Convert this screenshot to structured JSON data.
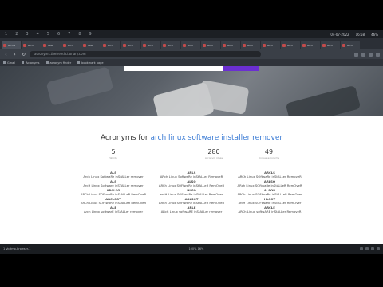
{
  "topbar": {
    "workspaces": [
      "1",
      "2",
      "3",
      "4",
      "5",
      "6",
      "7",
      "8",
      "9"
    ],
    "right_items": [
      "04-07-2022",
      "16:58",
      "46%"
    ]
  },
  "tabs": [
    {
      "title": "Arch L"
    },
    {
      "title": "Arch"
    },
    {
      "title": "Mod"
    },
    {
      "title": "Arch"
    },
    {
      "title": "Mod"
    },
    {
      "title": "Arch"
    },
    {
      "title": "Arch"
    },
    {
      "title": "Arch"
    },
    {
      "title": "Arch"
    },
    {
      "title": "Arch"
    },
    {
      "title": "Arch"
    },
    {
      "title": "Arch"
    },
    {
      "title": "Arch"
    },
    {
      "title": "Arch"
    },
    {
      "title": "Arch"
    },
    {
      "title": "Arch"
    },
    {
      "title": "Arch"
    },
    {
      "title": "Arch"
    }
  ],
  "urlbar": {
    "address": "acronyms.thefreedictionary.com"
  },
  "bookmarks": [
    "Gmail",
    "Acronyms",
    "acronym finder",
    "bookmark page"
  ],
  "main": {
    "heading_prefix": "Acronyms for",
    "heading_highlight": "arch linux software installer remover",
    "stats": [
      {
        "value": "5",
        "label": "Words"
      },
      {
        "value": "280",
        "label": "Acronym ideas"
      },
      {
        "value": "49",
        "label": "Unique acronyms"
      }
    ],
    "columns": [
      [
        {
          "acronym": "ALS",
          "expansion": "Arch Linux SoftwaRe inStALLer remover"
        },
        {
          "acronym": "ALS",
          "expansion": "ArcH Linux Software inSTALLer remover"
        },
        {
          "acronym": "ARCLSO",
          "expansion": "ARCh Linux SOFtwaRe inStALLeR RemOveR"
        },
        {
          "acronym": "ARCLSOT",
          "expansion": "ARCh Linux SOFtwaRe inStALLeR RemOveR"
        },
        {
          "acronym": "ALE",
          "expansion": "Arch Linux softwarE inStALLer remover"
        }
      ],
      [
        {
          "acronym": "ARLS",
          "expansion": "ARch Linux SoftwaRe inStALLer RemoveR"
        },
        {
          "acronym": "ALSO",
          "expansion": "ARCh Linux SOFtwaRe inStALLeR RemOveR"
        },
        {
          "acronym": "HLSO",
          "expansion": "arcH Linux SOFtwaRe inStALLer RemOver"
        },
        {
          "acronym": "ARLSOT",
          "expansion": "ARCh Linux SOFtwaRe inStALLeR RemOveR"
        },
        {
          "acronym": "ARLE",
          "expansion": "ARch Linux softwARE inStALLer remover"
        }
      ],
      [
        {
          "acronym": "ARCLS",
          "expansion": "ARCh Linux SOftwaRe inStALLer RemoveR"
        },
        {
          "acronym": "ARLSO",
          "expansion": "ARch Linux SOftwaRe inStALLeR RemOveR"
        },
        {
          "acronym": "ALSOR",
          "expansion": "ARCh Linux SOFtwaRe inStALLeR RemOver"
        },
        {
          "acronym": "HLSOT",
          "expansion": "arcH Linux SOFtwaRe inStALLer RemOver"
        },
        {
          "acronym": "ARCLE",
          "expansion": "ARCh Linux softwARE inStALLer RemoveR"
        }
      ]
    ]
  },
  "statusbar": {
    "left": "1 vb-tmp-browser-1",
    "mid": "100% 16%"
  }
}
